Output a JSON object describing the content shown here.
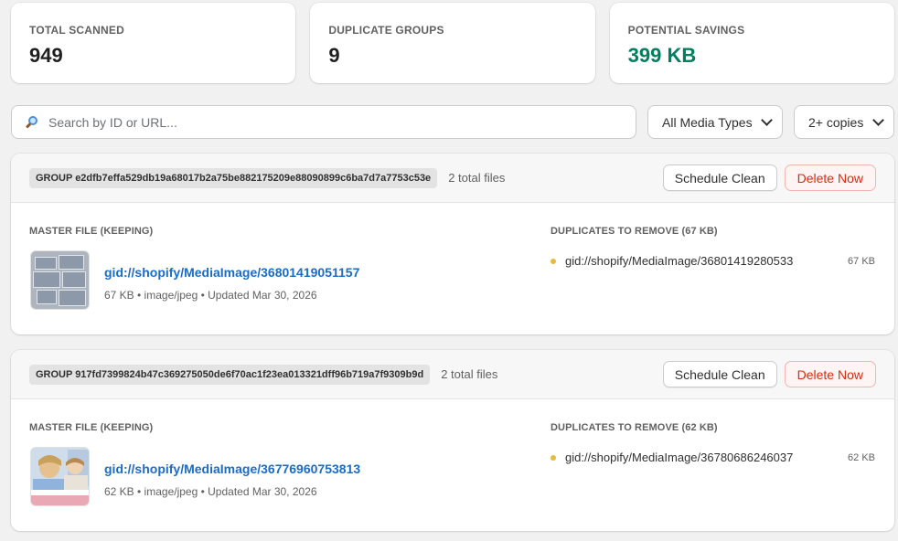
{
  "stats": {
    "total_scanned": {
      "label": "TOTAL SCANNED",
      "value": "949"
    },
    "duplicate_groups": {
      "label": "DUPLICATE GROUPS",
      "value": "9"
    },
    "potential_savings": {
      "label": "POTENTIAL SAVINGS",
      "value": "399 KB",
      "color": "#008060"
    }
  },
  "filters": {
    "search_placeholder": "Search by ID or URL...",
    "media_type": "All Media Types",
    "copies": "2+ copies"
  },
  "groups": [
    {
      "id_label": "GROUP e2dfb7effa529db19a68017b2a75be882175209e88090899c6ba7d7a7753c53e",
      "count": "2 total files",
      "schedule_label": "Schedule Clean",
      "delete_label": "Delete Now",
      "master_label": "MASTER FILE (KEEPING)",
      "master_id": "gid://shopify/MediaImage/36801419051157",
      "master_meta": "67 KB • image/jpeg • Updated Mar 30, 2026",
      "dups_label": "DUPLICATES TO REMOVE (67 KB)",
      "dup_id": "gid://shopify/MediaImage/36801419280533",
      "dup_size": "67 KB"
    },
    {
      "id_label": "GROUP 917fd7399824b47c369275050de6f70ac1f23ea013321dff96b719a7f9309b9d",
      "count": "2 total files",
      "schedule_label": "Schedule Clean",
      "delete_label": "Delete Now",
      "master_label": "MASTER FILE (KEEPING)",
      "master_id": "gid://shopify/MediaImage/36776960753813",
      "master_meta": "62 KB • image/jpeg • Updated Mar 30, 2026",
      "dups_label": "DUPLICATES TO REMOVE (62 KB)",
      "dup_id": "gid://shopify/MediaImage/36780686246037",
      "dup_size": "62 KB"
    }
  ],
  "colors": {
    "accent_link": "#1a6cc5",
    "danger": "#d72c0d",
    "dup_dot": "#e8b93a"
  },
  "icons": {
    "search": "search-icon",
    "dropdown": "chevron-down-icon"
  }
}
